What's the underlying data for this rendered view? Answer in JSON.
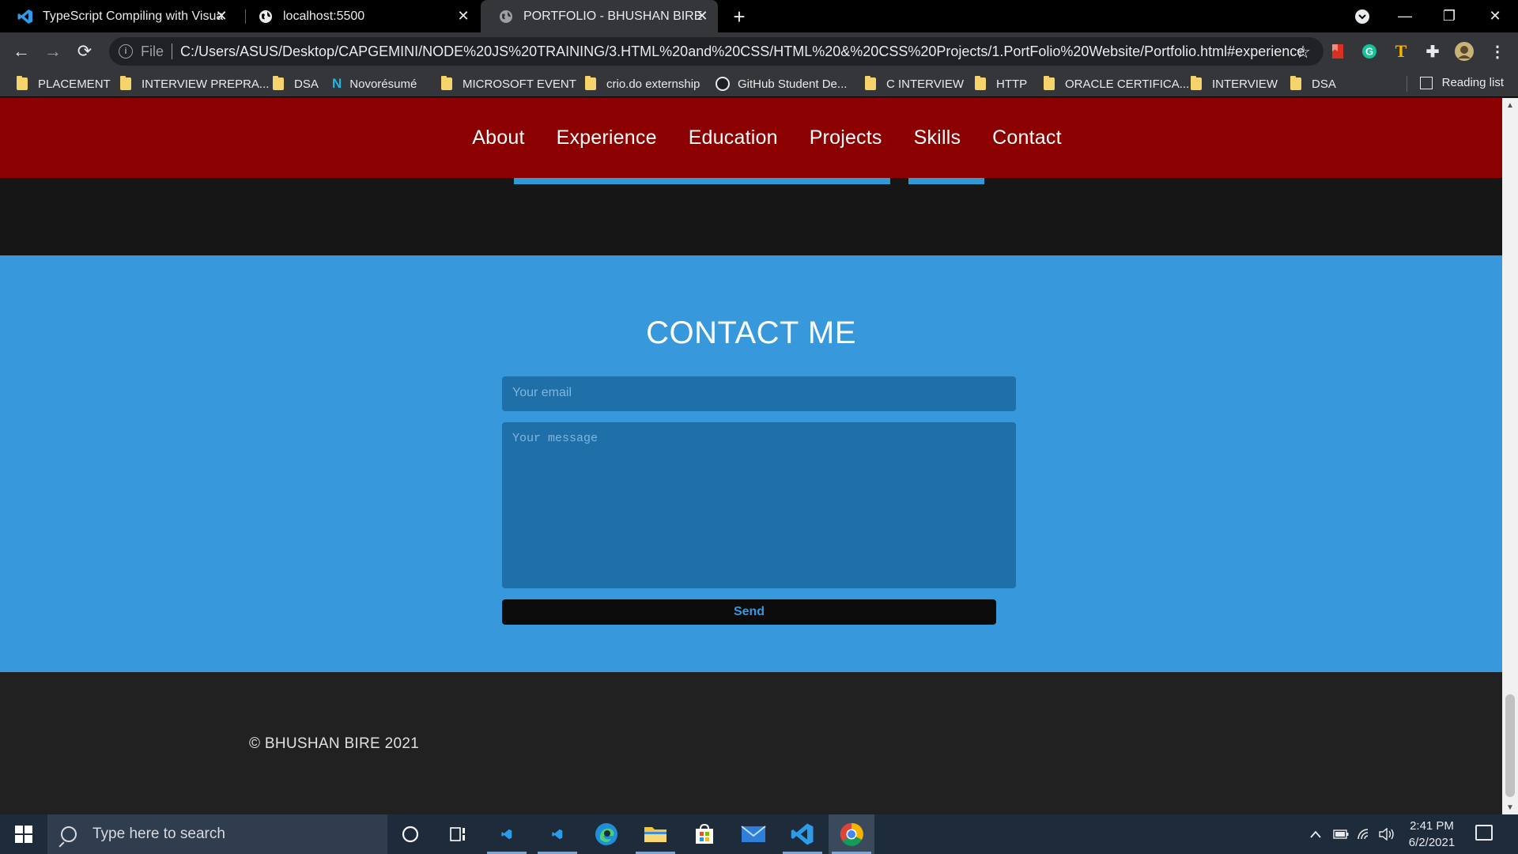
{
  "browser": {
    "tabs": [
      {
        "title": "TypeScript Compiling with Visual",
        "icon": "vscode-icon"
      },
      {
        "title": "localhost:5500",
        "icon": "globe-icon"
      },
      {
        "title": "PORTFOLIO - BHUSHAN BIRE",
        "icon": "globe-icon"
      }
    ],
    "omnibox": {
      "scheme": "File",
      "url": "C:/Users/ASUS/Desktop/CAPGEMINI/NODE%20JS%20TRAINING/3.HTML%20and%20CSS/HTML%20&%20CSS%20Projects/1.PortFolio%20Website/Portfolio.html#experience"
    },
    "bookmarks": [
      {
        "label": "PLACEMENT",
        "kind": "folder"
      },
      {
        "label": "INTERVIEW PREPRA...",
        "kind": "folder"
      },
      {
        "label": "DSA",
        "kind": "folder"
      },
      {
        "label": "Novorésumé",
        "kind": "novoresume"
      },
      {
        "label": "MICROSOFT EVENT",
        "kind": "folder"
      },
      {
        "label": "crio.do externship",
        "kind": "folder"
      },
      {
        "label": "GitHub Student De...",
        "kind": "github"
      },
      {
        "label": "C INTERVIEW",
        "kind": "folder"
      },
      {
        "label": "HTTP",
        "kind": "folder"
      },
      {
        "label": "ORACLE CERTIFICA...",
        "kind": "folder"
      },
      {
        "label": "INTERVIEW",
        "kind": "folder"
      },
      {
        "label": "DSA",
        "kind": "folder"
      }
    ],
    "reading_list": "Reading list"
  },
  "page": {
    "nav": [
      "About",
      "Experience",
      "Education",
      "Projects",
      "Skills",
      "Contact"
    ],
    "contact": {
      "heading": "CONTACT ME",
      "email_placeholder": "Your email",
      "message_placeholder": "Your message",
      "send_label": "Send"
    },
    "footer": {
      "copyright": "© BHUSHAN BIRE 2021"
    },
    "colors": {
      "nav_bg": "#8b0000",
      "contact_bg": "#3798db",
      "footer_bg": "#212121"
    }
  },
  "taskbar": {
    "search_placeholder": "Type here to search",
    "time": "2:41 PM",
    "date": "6/2/2021"
  }
}
